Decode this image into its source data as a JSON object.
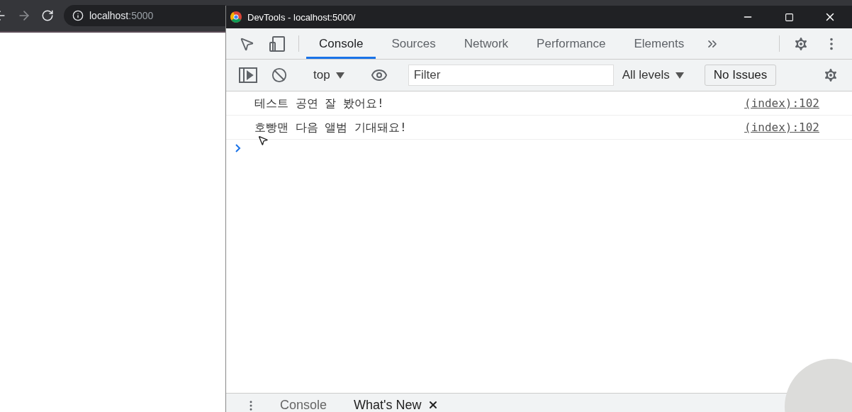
{
  "browser": {
    "address": {
      "host": "localhost",
      "port": ":5000"
    }
  },
  "devtools": {
    "window": {
      "title": "DevTools - localhost:5000/"
    },
    "tabs": [
      {
        "label": "Console",
        "selected": true
      },
      {
        "label": "Sources",
        "selected": false
      },
      {
        "label": "Network",
        "selected": false
      },
      {
        "label": "Performance",
        "selected": false
      },
      {
        "label": "Elements",
        "selected": false
      }
    ],
    "console_toolbar": {
      "context": "top",
      "filter": {
        "placeholder": "Filter"
      },
      "levels": "All levels",
      "issues": "No Issues"
    },
    "messages": [
      {
        "text": "테스트 공연 잘 봤어요!",
        "source": "(index):102"
      },
      {
        "text": "호빵맨 다음 앨범 기대돼요!",
        "source": "(index):102"
      }
    ],
    "drawer_tabs": [
      {
        "label": "Console",
        "selected": false,
        "closable": false
      },
      {
        "label": "What's New",
        "selected": true,
        "closable": true
      }
    ]
  }
}
